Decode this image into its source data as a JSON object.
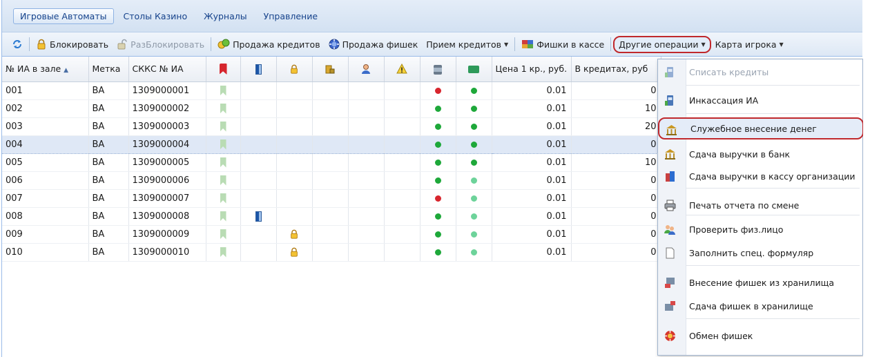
{
  "tabs": [
    {
      "label": "Игровые Автоматы",
      "active": true
    },
    {
      "label": "Столы Казино",
      "active": false
    },
    {
      "label": "Журналы",
      "active": false
    },
    {
      "label": "Управление",
      "active": false
    }
  ],
  "toolbar": {
    "block": "Блокировать",
    "unblock": "РазБлокировать",
    "sell_credits": "Продажа кредитов",
    "sell_chips": "Продажа фишек",
    "accept_credits": "Прием кредитов",
    "chips_cash": "Фишки в кассе",
    "other_ops": "Другие операции",
    "player_card": "Карта игрока"
  },
  "table": {
    "headers": {
      "num": "№ ИА в зале",
      "sort_arrow": "▲",
      "mark": "Метка",
      "skkc": "СККС № ИА",
      "price": "Цена 1 кр., руб.",
      "credits": "В кредитах, руб"
    },
    "rows": [
      {
        "num": "001",
        "mark": "ВА",
        "skkc": "1309000001",
        "door": false,
        "lock": false,
        "status": "red",
        "net": "green",
        "price": "0.01",
        "credits": "0"
      },
      {
        "num": "002",
        "mark": "ВА",
        "skkc": "1309000002",
        "door": false,
        "lock": false,
        "status": "green",
        "net": "green",
        "price": "0.01",
        "credits": "10"
      },
      {
        "num": "003",
        "mark": "ВА",
        "skkc": "1309000003",
        "door": false,
        "lock": false,
        "status": "green",
        "net": "green",
        "price": "0.01",
        "credits": "20"
      },
      {
        "num": "004",
        "mark": "ВА",
        "skkc": "1309000004",
        "door": false,
        "lock": false,
        "status": "green",
        "net": "green",
        "price": "0.01",
        "credits": "0",
        "selected": true
      },
      {
        "num": "005",
        "mark": "ВА",
        "skkc": "1309000005",
        "door": false,
        "lock": false,
        "status": "green",
        "net": "green",
        "price": "0.01",
        "credits": "10"
      },
      {
        "num": "006",
        "mark": "ВА",
        "skkc": "1309000006",
        "door": false,
        "lock": false,
        "status": "green",
        "net": "lightgreen",
        "price": "0.01",
        "credits": "0"
      },
      {
        "num": "007",
        "mark": "ВА",
        "skkc": "1309000007",
        "door": false,
        "lock": false,
        "status": "red",
        "net": "lightgreen",
        "price": "0.01",
        "credits": "0"
      },
      {
        "num": "008",
        "mark": "ВА",
        "skkc": "1309000008",
        "door": true,
        "lock": false,
        "status": "green",
        "net": "lightgreen",
        "price": "0.01",
        "credits": "0"
      },
      {
        "num": "009",
        "mark": "ВА",
        "skkc": "1309000009",
        "door": false,
        "lock": true,
        "status": "green",
        "net": "lightgreen",
        "price": "0.01",
        "credits": "0"
      },
      {
        "num": "010",
        "mark": "ВА",
        "skkc": "1309000010",
        "door": false,
        "lock": true,
        "status": "green",
        "net": "lightgreen",
        "price": "0.01",
        "credits": "0"
      }
    ]
  },
  "menu": {
    "items": [
      {
        "label": "Списать кредиты",
        "icon": "slot-machine-icon",
        "disabled": true
      },
      {
        "label": "Инкассация ИА",
        "icon": "slot-machine-icon"
      },
      {
        "label": "Служебное внесение денег",
        "icon": "bank-icon",
        "active": true
      },
      {
        "label": "Сдача выручки в банк",
        "icon": "bank-icon"
      },
      {
        "label": "Сдача выручки в кассу организации",
        "icon": "office-building-icon"
      },
      {
        "label": "Печать отчета по смене",
        "icon": "printer-icon"
      },
      {
        "label": "Проверить физ.лицо",
        "icon": "users-icon"
      },
      {
        "label": "Заполнить спец. формуляр",
        "icon": "document-icon"
      },
      {
        "label": "Внесение фишек из хранилища",
        "icon": "chips-in-icon"
      },
      {
        "label": "Сдача фишек в хранилище",
        "icon": "chips-out-icon"
      },
      {
        "label": "Обмен фишек",
        "icon": "chip-icon"
      }
    ]
  },
  "colors": {
    "status_red": "#d8262e",
    "status_green": "#1ea83a",
    "status_lightgreen": "#6dd39a",
    "highlight_red": "#c0282c",
    "tab_text": "#15428b"
  }
}
